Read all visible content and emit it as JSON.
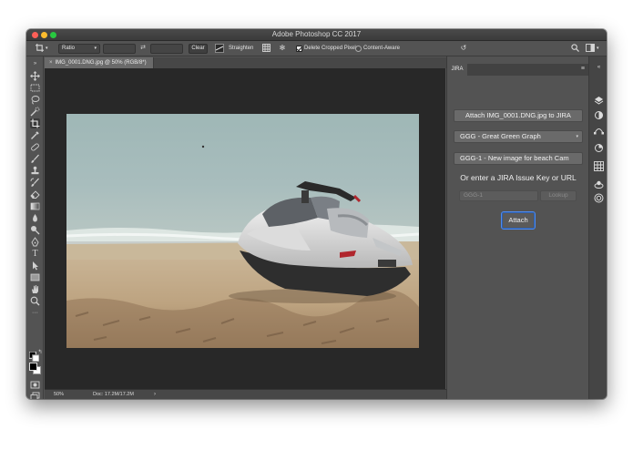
{
  "window": {
    "title": "Adobe Photoshop CC 2017"
  },
  "options_bar": {
    "ratio_label": "Ratio",
    "clear_label": "Clear",
    "straighten_label": "Straighten",
    "delete_cropped_label": "Delete Cropped Pixels",
    "delete_cropped_checked": true,
    "content_aware_label": "Content-Aware",
    "content_aware_checked": false
  },
  "document": {
    "tab_label": "IMG_0001.DNG.jpg @ 50% (RGB/8*)",
    "zoom": "50%",
    "doc_size": "Doc: 17.2M/17.2M"
  },
  "tools": [
    "move-tool",
    "marquee-tool",
    "lasso-tool",
    "quick-select-tool",
    "crop-tool",
    "eyedropper-tool",
    "healing-tool",
    "brush-tool",
    "clone-stamp-tool",
    "history-brush-tool",
    "eraser-tool",
    "gradient-tool",
    "blur-tool",
    "dodge-tool",
    "pen-tool",
    "type-tool",
    "path-select-tool",
    "shape-tool",
    "hand-tool",
    "zoom-tool",
    "more-tools"
  ],
  "jira_panel": {
    "tab_label": "JIRA",
    "attach_to_label": "Attach IMG_0001.DNG.jpg to JIRA",
    "project_select": "GGG - Great Green Graph",
    "issue_select": "GGG-1 - New image for beach Cam",
    "prompt_text": "Or enter a JIRA Issue Key or URL",
    "issue_key_placeholder": "GGG-1",
    "lookup_label": "Lookup",
    "attach_label": "Attach"
  },
  "colors": {
    "ui_dark": "#535353",
    "canvas_bg": "#282828",
    "focus_accent": "#4d8bf0",
    "foreground": "#000000",
    "background": "#ffffff"
  }
}
